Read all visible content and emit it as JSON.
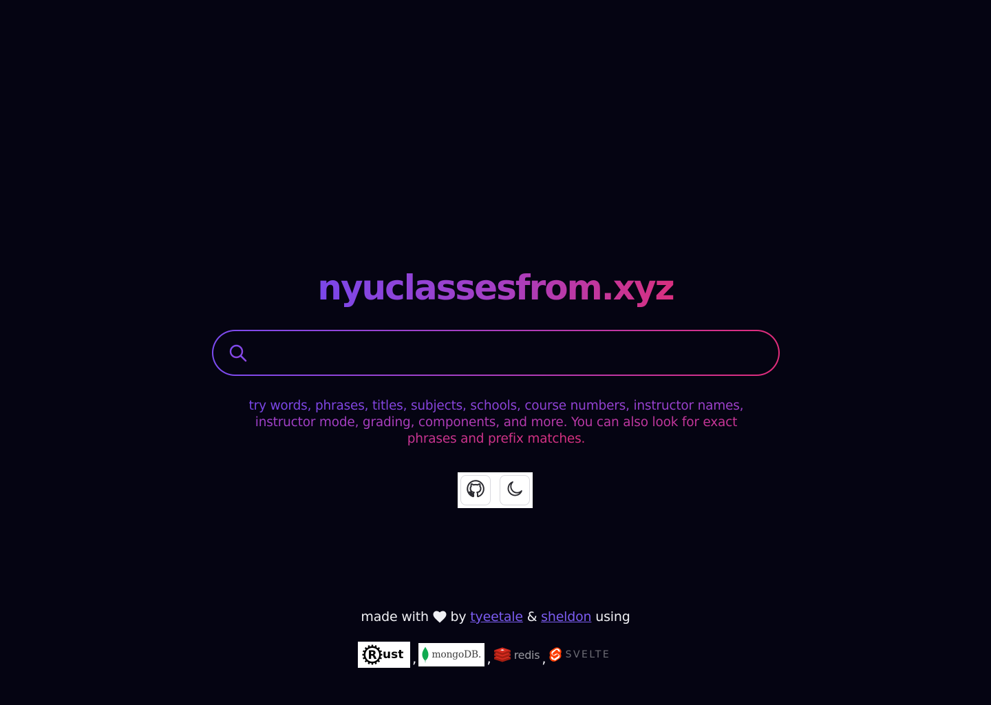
{
  "site": {
    "title": "nyuclassesfrom.xyz"
  },
  "search": {
    "value": "",
    "placeholder": ""
  },
  "hint": {
    "text": "try words, phrases, titles, subjects, schools, course numbers, instructor names, instructor mode, grading, components, and more. You can also look for exact phrases and prefix matches."
  },
  "buttons": {
    "github_icon": "github-icon",
    "theme_icon": "moon-icon"
  },
  "credits": {
    "prefix": "made with",
    "by": "by",
    "author1": "tyeetale",
    "amp": "&",
    "author2": "sheldon",
    "suffix": "using"
  },
  "tech": {
    "rust": "ust",
    "mongo": "mongoDB.",
    "redis": "redis",
    "svelte": "SVELTE",
    "separator": ","
  },
  "colors": {
    "background": "#050412",
    "gradient_start": "#7a47ea",
    "gradient_end": "#d8307f",
    "link": "#7b5cf0"
  }
}
